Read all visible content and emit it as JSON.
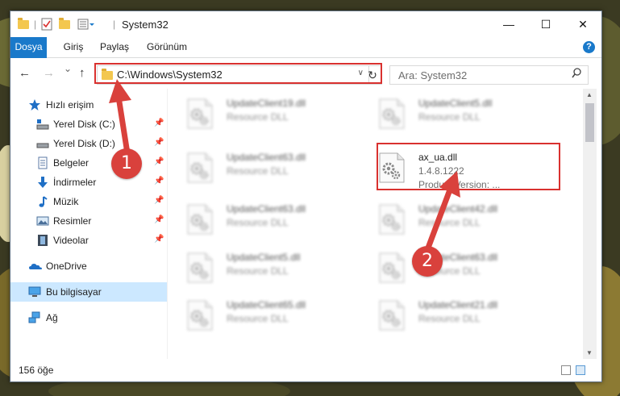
{
  "window": {
    "title": "System32",
    "controls": {
      "minimize": "—",
      "maximize": "☐",
      "close": "✕"
    }
  },
  "ribbon": {
    "tabs": [
      "Dosya",
      "Giriş",
      "Paylaş",
      "Görünüm"
    ],
    "help": "?"
  },
  "nav": {
    "back": "←",
    "forward": "→",
    "recent": "⌄",
    "up": "↑",
    "address": "C:\\Windows\\System32",
    "refresh": "↻",
    "search_placeholder": "Ara: System32",
    "search_icon": "search-icon"
  },
  "sidebar": {
    "items": [
      {
        "label": "Hızlı erişim",
        "icon": "star-icon",
        "pinned": false
      },
      {
        "label": "Yerel Disk (C:)",
        "icon": "drive-icon",
        "pinned": true
      },
      {
        "label": "Yerel Disk (D:)",
        "icon": "drive-icon",
        "pinned": true
      },
      {
        "label": "Belgeler",
        "icon": "documents-icon",
        "pinned": true
      },
      {
        "label": "İndirmeler",
        "icon": "download-icon",
        "pinned": true
      },
      {
        "label": "Müzik",
        "icon": "music-icon",
        "pinned": true
      },
      {
        "label": "Resimler",
        "icon": "pictures-icon",
        "pinned": true
      },
      {
        "label": "Videolar",
        "icon": "videos-icon",
        "pinned": true
      },
      {
        "label": "OneDrive",
        "icon": "cloud-icon",
        "pinned": false
      },
      {
        "label": "Bu bilgisayar",
        "icon": "computer-icon",
        "pinned": false,
        "selected": true
      },
      {
        "label": "Ağ",
        "icon": "network-icon",
        "pinned": false
      }
    ],
    "pin_glyph": "📌"
  },
  "files": [
    {
      "name": "UpdateClient19.dll",
      "type": "Resource DLL"
    },
    {
      "name": "UpdateClient5.dll",
      "type": "Resource DLL"
    },
    {
      "name": "UpdateClient63.dll",
      "type": "Resource DLL"
    },
    {
      "name": "ax_ua.dll",
      "version": "1.4.8.1222",
      "type": "Product Version:   ...",
      "highlighted": true
    },
    {
      "name": "UpdateClient63.dll",
      "type": "Resource DLL"
    },
    {
      "name": "UpdateClient42.dll",
      "type": "Resource DLL"
    },
    {
      "name": "UpdateClient5.dll",
      "type": "Resource DLL"
    },
    {
      "name": "UpdateClient63.dll",
      "type": "Resource DLL"
    },
    {
      "name": "UpdateClient65.dll",
      "type": "Resource DLL"
    },
    {
      "name": "UpdateClient21.dll",
      "type": "Resource DLL"
    }
  ],
  "status": {
    "count": "156 öğe"
  },
  "callouts": [
    "1",
    "2"
  ],
  "colors": {
    "accent": "#1979ca",
    "highlight": "#d9312f",
    "selected": "#cce8ff"
  }
}
